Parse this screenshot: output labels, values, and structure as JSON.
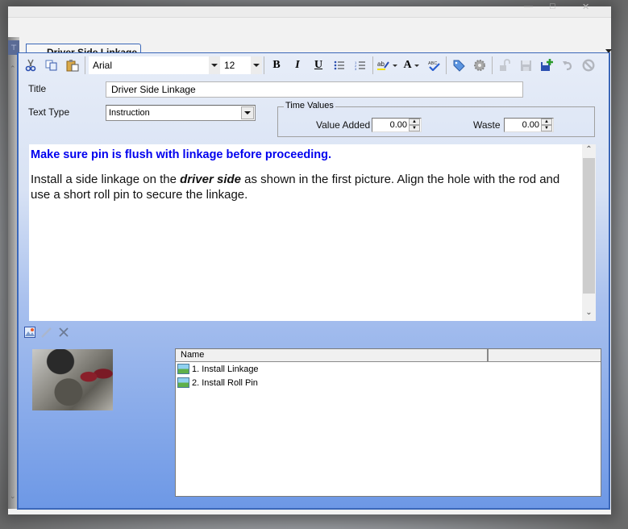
{
  "window": {
    "controls": [
      "minimize",
      "maximize",
      "close"
    ]
  },
  "document_tab": {
    "label": "Driver Side Linkage"
  },
  "toolbar": {
    "font_name": "Arial",
    "font_size": "12",
    "bold": "B",
    "italic": "I",
    "underline": "U",
    "font_color": "A",
    "icons": [
      "cut-icon",
      "copy-icon",
      "paste-icon",
      "bold-icon",
      "italic-icon",
      "underline-icon",
      "bullet-list-icon",
      "numbered-list-icon",
      "highlight-icon",
      "font-color-icon",
      "spellcheck-icon",
      "tag-icon",
      "settings-icon",
      "unlock-icon",
      "save-icon",
      "save-new-icon",
      "undo-icon",
      "cancel-icon"
    ]
  },
  "form": {
    "title_label": "Title",
    "title_value": "Driver Side Linkage",
    "text_type_label": "Text Type",
    "text_type_value": "Instruction",
    "time_values": {
      "legend": "Time Values",
      "value_added_label": "Value Added",
      "value_added": "0.00",
      "waste_label": "Waste",
      "waste": "0.00"
    }
  },
  "editor": {
    "warning": "Make sure pin is flush with linkage before proceeding.",
    "body_before": "Install a side linkage on the ",
    "body_emphasis": "driver side",
    "body_after": " as shown in the first picture. Align the hole with the rod and use a short roll pin to secure the linkage.",
    "warning_color": "#0000ee"
  },
  "images": {
    "toolbar_icons": [
      "add-image-icon",
      "edit-pencil-icon",
      "delete-x-icon"
    ],
    "list_header": "Name",
    "items": [
      {
        "label": "1. Install Linkage"
      },
      {
        "label": "2. Install Roll Pin"
      }
    ]
  },
  "colors": {
    "accent_border": "#3b67b8",
    "panel_gradient_bottom": "#6d98e6"
  }
}
